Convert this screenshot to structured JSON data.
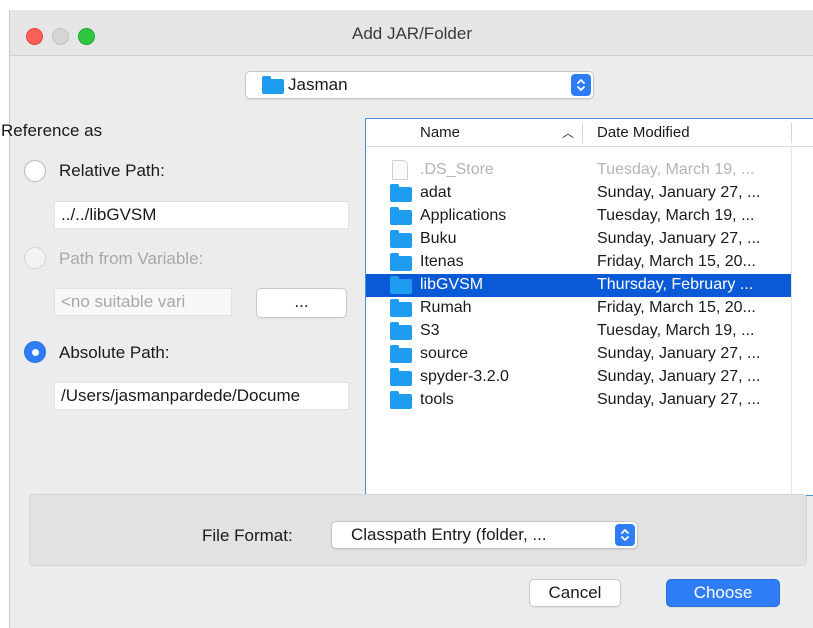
{
  "window": {
    "title": "Add JAR/Folder"
  },
  "location": {
    "folder": "Jasman"
  },
  "reference": {
    "heading": "Reference as",
    "relative": {
      "label": "Relative Path:",
      "value": "../../libGVSM"
    },
    "variable": {
      "label": "Path from Variable:",
      "value": "<no suitable vari",
      "browse_label": "..."
    },
    "absolute": {
      "label": "Absolute Path:",
      "value": "/Users/jasmanpardede/Docume"
    }
  },
  "filelist": {
    "headers": {
      "name": "Name",
      "date": "Date Modified"
    },
    "rows": [
      {
        "name": ".DS_Store",
        "date": "Tuesday, March 19, ..."
      },
      {
        "name": "adat",
        "date": "Sunday, January 27, ..."
      },
      {
        "name": "Applications",
        "date": "Tuesday, March 19, ..."
      },
      {
        "name": "Buku",
        "date": "Sunday, January 27, ..."
      },
      {
        "name": "Itenas",
        "date": "Friday, March 15, 20..."
      },
      {
        "name": "libGVSM",
        "date": "Thursday, February ..."
      },
      {
        "name": "Rumah",
        "date": "Friday, March 15, 20..."
      },
      {
        "name": "S3",
        "date": "Tuesday, March 19, ..."
      },
      {
        "name": "source",
        "date": "Sunday, January 27, ..."
      },
      {
        "name": "spyder-3.2.0",
        "date": "Sunday, January 27, ..."
      },
      {
        "name": "tools",
        "date": "Sunday, January 27, ..."
      }
    ]
  },
  "format": {
    "label": "File Format:",
    "value": "Classpath Entry (folder, ..."
  },
  "buttons": {
    "cancel": "Cancel",
    "choose": "Choose"
  },
  "colors": {
    "accent": "#2f7df6",
    "selection": "#0a5ad8",
    "folder": "#1e9cf0"
  }
}
